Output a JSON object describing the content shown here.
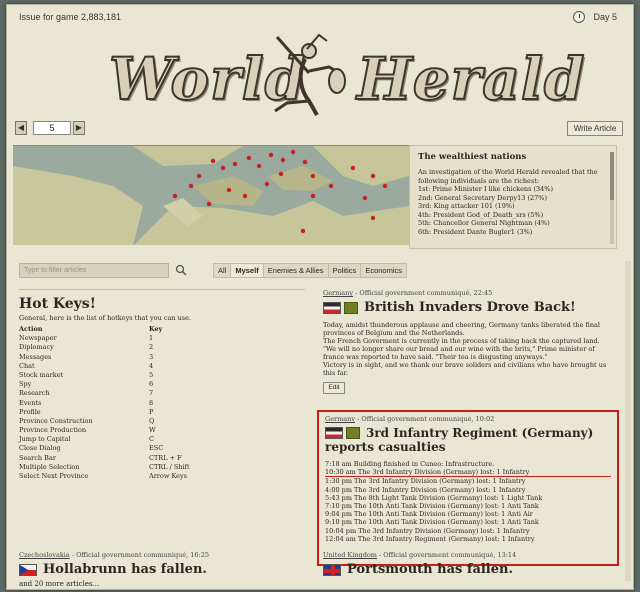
{
  "header": {
    "issue": "Issue for game 2,883,181",
    "day": "Day 5"
  },
  "masthead": {
    "left": "World",
    "right": "Herald"
  },
  "nav": {
    "prev": "◀",
    "page": "5",
    "next": "▶",
    "write_article": "Write Article"
  },
  "wealth": {
    "title": "The wealthiest nations",
    "intro": "An investigation of the World Herald revealed that the following individuals are the richest:",
    "items": [
      "1st: Prime Minister I like chickens (34%)",
      "2nd: General Secretary Derpy13 (27%)",
      "3rd: King attacker 101 (19%)",
      "4th: President God_of_Death_srs (5%)",
      "5th: Chancellor General Nightman (4%)",
      "6th: President Dante Bugler1 (3%)"
    ]
  },
  "filter": {
    "placeholder": "Type to filter articles",
    "tabs": [
      "All",
      "Myself",
      "Enemies & Allies",
      "Politics",
      "Economics"
    ]
  },
  "hotkeys": {
    "title": "Hot Keys!",
    "desc": "General, here is the list of hotkeys that you can use.",
    "head_action": "Action",
    "head_key": "Key",
    "rows": [
      [
        "Newspaper",
        "1"
      ],
      [
        "Diplomacy",
        "2"
      ],
      [
        "Messages",
        "3"
      ],
      [
        "Chat",
        "4"
      ],
      [
        "Stock market",
        "5"
      ],
      [
        "Spy",
        "6"
      ],
      [
        "Research",
        "7"
      ],
      [
        "Events",
        "8"
      ],
      [
        "Profile",
        "P"
      ],
      [
        "Province Construction",
        "Q"
      ],
      [
        "Province Production",
        "W"
      ],
      [
        "Jump to Capital",
        "C"
      ],
      [
        "Close Dialog",
        "ESC"
      ],
      [
        "Search Bar",
        "CTRL + F"
      ],
      [
        "Multiple Selection",
        "CTRL / Shift"
      ],
      [
        "Select Next Province",
        "Arrow Keys"
      ]
    ]
  },
  "article1": {
    "country": "Germany",
    "meta": " - Official government communiqué, 22:45",
    "title": "British Invaders Drove Back!",
    "body": [
      "Today, amidst thunderous applause and cheering, Germany tanks liberated the final provinces of Belgium and the Netherlands.",
      "The French Goverment is currently in the process of taking back the captured land.",
      "\"We will no longer share our bread and our wine with the brits,\" Prime minister of france was reported to have said. \"Their tea is disgusting anyways.\"",
      "Victory is in sight, and we thank our brave soliders and civilians who have brought us this far."
    ],
    "edit": "Edit"
  },
  "article2": {
    "country": "Germany",
    "meta": " - Official government communiqué, 10:02",
    "title_line1": "3rd Infantry Regiment (Germany)",
    "title_line2": "reports casualties",
    "log": [
      "7:18 am Building finished in Cuneo: Infrastructure.",
      "10:30 am The 3rd Infantry Division (Germany) lost: 1 Infantry",
      "1:30 pm The 3rd Infantry Division (Germany) lost: 1 Infantry",
      "4:00 pm The 3rd Infantry Division (Germany) lost: 1 Infantry",
      "5:43 pm The 8th Light Tank Division (Germany) lost: 1 Light Tank",
      "7:10 pm The 10th Anti Tank Division (Germany) lost: 1 Anti Tank",
      "9:04 pm The 10th Anti Tank Division (Germany) lost: 1 Anti Air",
      "9:10 pm The 10th Anti Tank Division (Germany) lost: 1 Anti Tank",
      "10:04 pm The 3rd Infantry Division (Germany) lost: 1 Infantry",
      "12:04 am The 3rd Infantry Regiment (Germany) lost: 1 Infantry"
    ]
  },
  "article3": {
    "country": "Czechoslovakia",
    "meta": " - Official government communiqué, 16:25",
    "title": "Hollabrunn has fallen."
  },
  "article4": {
    "country": "United Kingdom",
    "meta": " - Official government communiqué, 13:14",
    "title": "Portsmouth has fallen."
  },
  "footer": {
    "more": "and 20 more articles..."
  }
}
